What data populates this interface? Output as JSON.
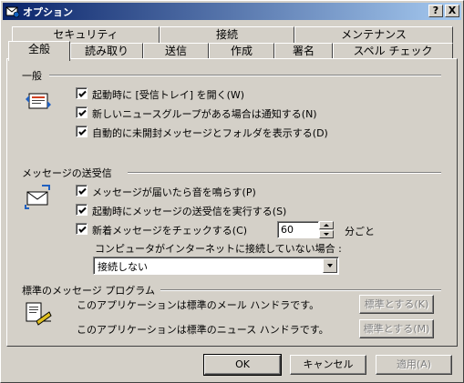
{
  "window": {
    "title": "オプション"
  },
  "titlebar_buttons": {
    "help": "?",
    "close": "X"
  },
  "tabs_back": [
    "セキュリティ",
    "接続",
    "メンテナンス"
  ],
  "tabs_front": [
    "全般",
    "読み取り",
    "送信",
    "作成",
    "署名",
    "スペル チェック"
  ],
  "sections": {
    "general": {
      "title": "一般",
      "options": [
        {
          "label": "起動時に [受信トレイ] を開く(W)",
          "checked": true
        },
        {
          "label": "新しいニュースグループがある場合は通知する(N)",
          "checked": true
        },
        {
          "label": "自動的に未開封メッセージとフォルダを表示する(D)",
          "checked": true
        }
      ]
    },
    "send_receive": {
      "title": "メッセージの送受信",
      "options": [
        {
          "label": "メッセージが届いたら音を鳴らす(P)",
          "checked": true
        },
        {
          "label": "起動時にメッセージの送受信を実行する(S)",
          "checked": true
        },
        {
          "label": "新着メッセージをチェックする(C)",
          "checked": true
        }
      ],
      "interval_value": "60",
      "interval_unit": "分ごと",
      "offline_label": "コンピュータがインターネットに接続していない場合 :",
      "offline_select": "接続しない"
    },
    "default_programs": {
      "title": "標準のメッセージ プログラム",
      "mail_text": "このアプリケーションは標準のメール ハンドラです。",
      "mail_button": "標準とする(K)",
      "news_text": "このアプリケーションは標準のニュース ハンドラです。",
      "news_button": "標準とする(M)"
    }
  },
  "footer": {
    "ok": "OK",
    "cancel": "キャンセル",
    "apply": "適用(A)"
  }
}
